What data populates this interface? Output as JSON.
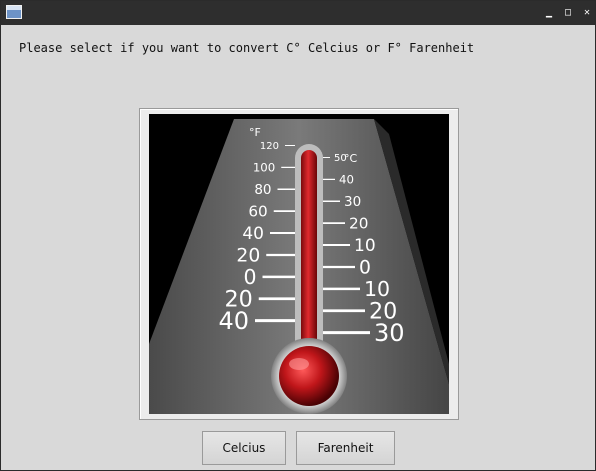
{
  "window": {
    "controls": {
      "minimize": "▁",
      "maximize": "□",
      "close": "✕"
    },
    "icon": "app-window-icon"
  },
  "prompt_text": "Please select if you want to convert C° Celcius or F° Farenheit",
  "thermometer": {
    "f_unit": "°F",
    "c_unit": "°C",
    "f_labels": [
      "120",
      "100",
      "80",
      "60",
      "40",
      "20",
      "0",
      "20",
      "40"
    ],
    "c_labels": [
      "50",
      "40",
      "30",
      "20",
      "10",
      "0",
      "10",
      "20",
      "30"
    ]
  },
  "buttons": {
    "celcius": "Celcius",
    "farenheit": "Farenheit"
  },
  "colors": {
    "titlebar": "#2e2e2e",
    "background": "#d9d9d9",
    "mercury": "#c0161a"
  }
}
